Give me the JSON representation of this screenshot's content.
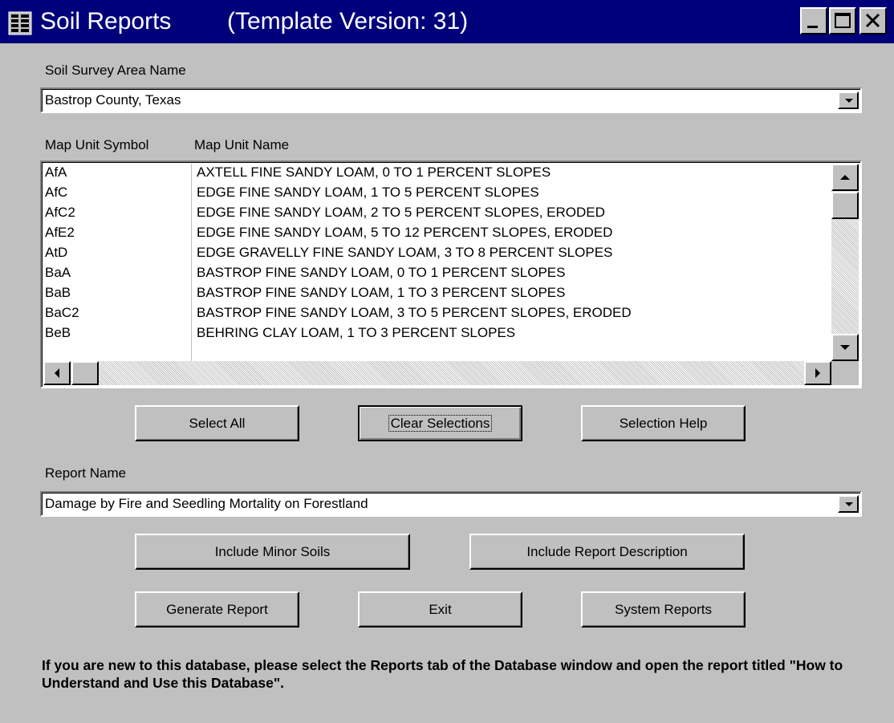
{
  "window": {
    "title": "Soil Reports",
    "version": "(Template Version: 31)"
  },
  "survey_area": {
    "label": "Soil Survey Area Name",
    "value": "Bastrop County, Texas"
  },
  "map_units": {
    "col_symbol": "Map Unit Symbol",
    "col_name": "Map Unit Name",
    "rows": [
      {
        "symbol": "AfA",
        "name": "AXTELL FINE SANDY LOAM, 0 TO 1 PERCENT SLOPES"
      },
      {
        "symbol": "AfC",
        "name": "EDGE FINE SANDY LOAM, 1 TO 5 PERCENT SLOPES"
      },
      {
        "symbol": "AfC2",
        "name": "EDGE FINE SANDY LOAM, 2 TO 5 PERCENT SLOPES, ERODED"
      },
      {
        "symbol": "AfE2",
        "name": "EDGE FINE SANDY LOAM, 5 TO 12 PERCENT SLOPES, ERODED"
      },
      {
        "symbol": "AtD",
        "name": "EDGE GRAVELLY FINE SANDY LOAM, 3 TO 8 PERCENT SLOPES"
      },
      {
        "symbol": "BaA",
        "name": "BASTROP FINE SANDY LOAM, 0 TO 1 PERCENT SLOPES"
      },
      {
        "symbol": "BaB",
        "name": "BASTROP FINE SANDY LOAM, 1 TO 3 PERCENT SLOPES"
      },
      {
        "symbol": "BaC2",
        "name": "BASTROP FINE SANDY LOAM, 3 TO 5 PERCENT SLOPES, ERODED"
      },
      {
        "symbol": "BeB",
        "name": "BEHRING CLAY LOAM, 1 TO 3 PERCENT SLOPES"
      }
    ]
  },
  "selection_buttons": {
    "select_all": "Select All",
    "clear_selections": "Clear Selections",
    "selection_help": "Selection Help"
  },
  "report": {
    "label": "Report Name",
    "value": "Damage by Fire and Seedling Mortality on Forestland"
  },
  "option_buttons": {
    "include_minor": "Include Minor Soils",
    "include_description": "Include Report Description"
  },
  "action_buttons": {
    "generate": "Generate Report",
    "exit": "Exit",
    "system_reports": "System Reports"
  },
  "footer_note": "If you are new to this database, please select the Reports tab of the Database window and open the report titled \"How to Understand and Use this Database\"."
}
